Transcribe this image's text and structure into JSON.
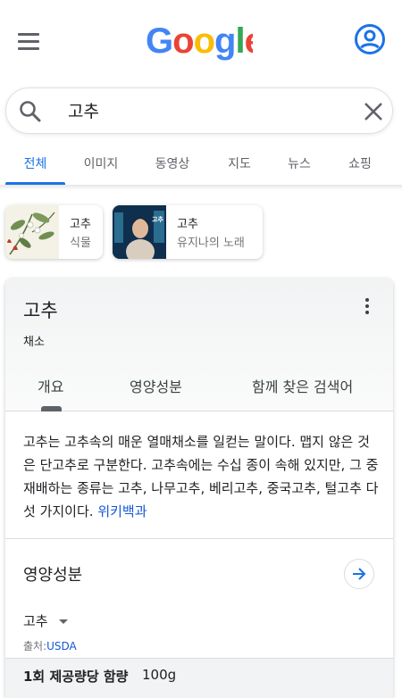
{
  "header": {
    "logo_text": "Google",
    "logo_colors": [
      "#4285F4",
      "#EA4335",
      "#FBBC05",
      "#4285F4",
      "#34A853",
      "#EA4335"
    ],
    "menu_icon": "hamburger-menu-icon",
    "account_icon": "account-circle-icon"
  },
  "search": {
    "query": "고추",
    "search_icon": "search-icon",
    "clear_icon": "close-icon"
  },
  "tabs": [
    {
      "label": "전체",
      "active": true
    },
    {
      "label": "이미지",
      "active": false
    },
    {
      "label": "동영상",
      "active": false
    },
    {
      "label": "지도",
      "active": false
    },
    {
      "label": "뉴스",
      "active": false
    },
    {
      "label": "쇼핑",
      "active": false
    }
  ],
  "chips": [
    {
      "title": "고추",
      "subtitle": "식물"
    },
    {
      "title": "고추",
      "subtitle": "유지나의 노래"
    }
  ],
  "knowledge_panel": {
    "title": "고추",
    "subtitle": "채소",
    "tabs": [
      "개요",
      "영양성분",
      "함께 찾은 검색어"
    ],
    "description": "고추는 고추속의 매운 열매채소를 일컫는 말이다. 맵지 않은 것은 단고추로 구분한다. 고추속에는 수십 종이 속해 있지만, 그 중 재배하는 종류는 고추, 나무고추, 베리고추, 중국고추, 털고추 다섯 가지이다.",
    "description_link": "위키백과",
    "nutrition": {
      "title": "영양성분",
      "food": "고추",
      "source_prefix": "출처:",
      "source_link": "USDA",
      "serving_label": "1회 제공량당 함량",
      "serving_value": "100g"
    }
  },
  "accent_color": "#1a73e8"
}
